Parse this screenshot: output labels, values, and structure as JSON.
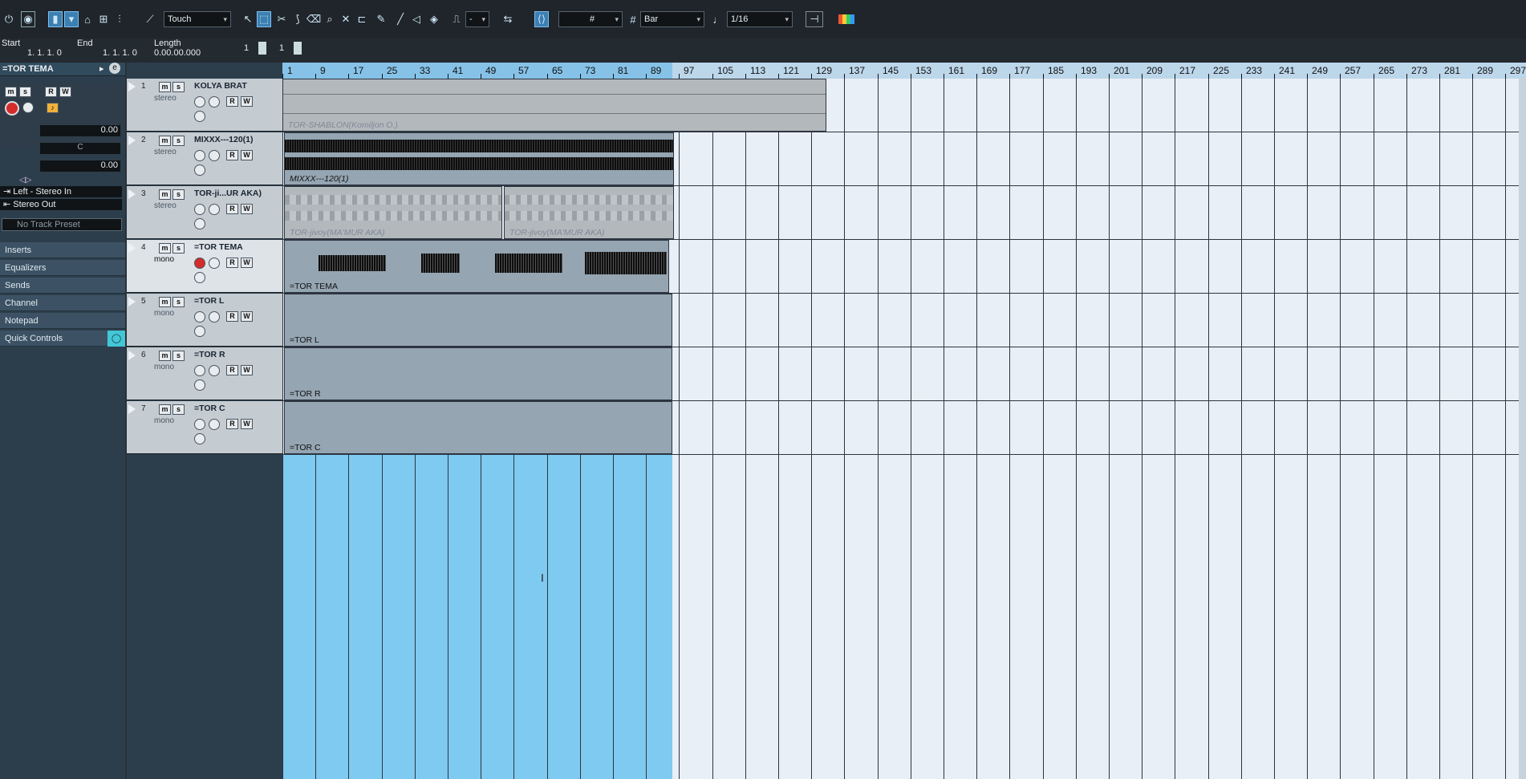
{
  "toolbar": {
    "automation_mode": "Touch",
    "quantize_mode": "Bar",
    "quantize_value": "1/16",
    "nudge_value": "-",
    "grid_icon": "grid-icon"
  },
  "info_line": {
    "start_label": "Start",
    "start_value": "1. 1. 1. 0",
    "end_label": "End",
    "end_value": "1. 1. 1. 0",
    "length_label": "Length",
    "length_value": "0.00.00.000",
    "spin1": "1",
    "spin2": "1"
  },
  "inspector": {
    "track_name": "=TOR TEMA",
    "volume": "0.00",
    "pan": "C",
    "delay": "0.00",
    "input": "Left - Stereo In",
    "output": "Stereo Out",
    "preset_placeholder": "No Track Preset",
    "sections": [
      "Inserts",
      "Equalizers",
      "Sends",
      "Channel",
      "Notepad",
      "Quick Controls"
    ],
    "quick_controls_color": "#43c6d6"
  },
  "tracks": [
    {
      "num": "1",
      "name": "KOLYA BRAT",
      "type": "stereo"
    },
    {
      "num": "2",
      "name": "MIXXX---120(1)",
      "type": "stereo"
    },
    {
      "num": "3",
      "name": "TOR-ji...UR AKA)",
      "type": "stereo"
    },
    {
      "num": "4",
      "name": "=TOR TEMA",
      "type": "mono"
    },
    {
      "num": "5",
      "name": "=TOR L",
      "type": "mono"
    },
    {
      "num": "6",
      "name": "=TOR R",
      "type": "mono"
    },
    {
      "num": "7",
      "name": "=TOR C",
      "type": "mono"
    }
  ],
  "buttons": {
    "m": "m",
    "s": "s",
    "r": "R",
    "w": "W",
    "e": "e"
  },
  "ruler": [
    "1",
    "9",
    "17",
    "25",
    "33",
    "41",
    "49",
    "57",
    "65",
    "73",
    "81",
    "89",
    "97",
    "105",
    "113",
    "121",
    "129",
    "137",
    "145",
    "153",
    "161",
    "169",
    "177",
    "185",
    "193",
    "201",
    "209",
    "217",
    "225",
    "233",
    "241",
    "249",
    "257",
    "265",
    "273",
    "281",
    "289",
    "297"
  ],
  "events": {
    "e1": "TOR-SHABLON(Komiljon O.)",
    "e2": "MIXXX---120(1)",
    "e3a": "TOR-jivoy(MA'MUR AKA)",
    "e3b": "TOR-jivoy(MA'MUR AKA)",
    "e4": "=TOR TEMA",
    "e5": "=TOR L",
    "e6": "=TOR R",
    "e7": "=TOR C"
  }
}
